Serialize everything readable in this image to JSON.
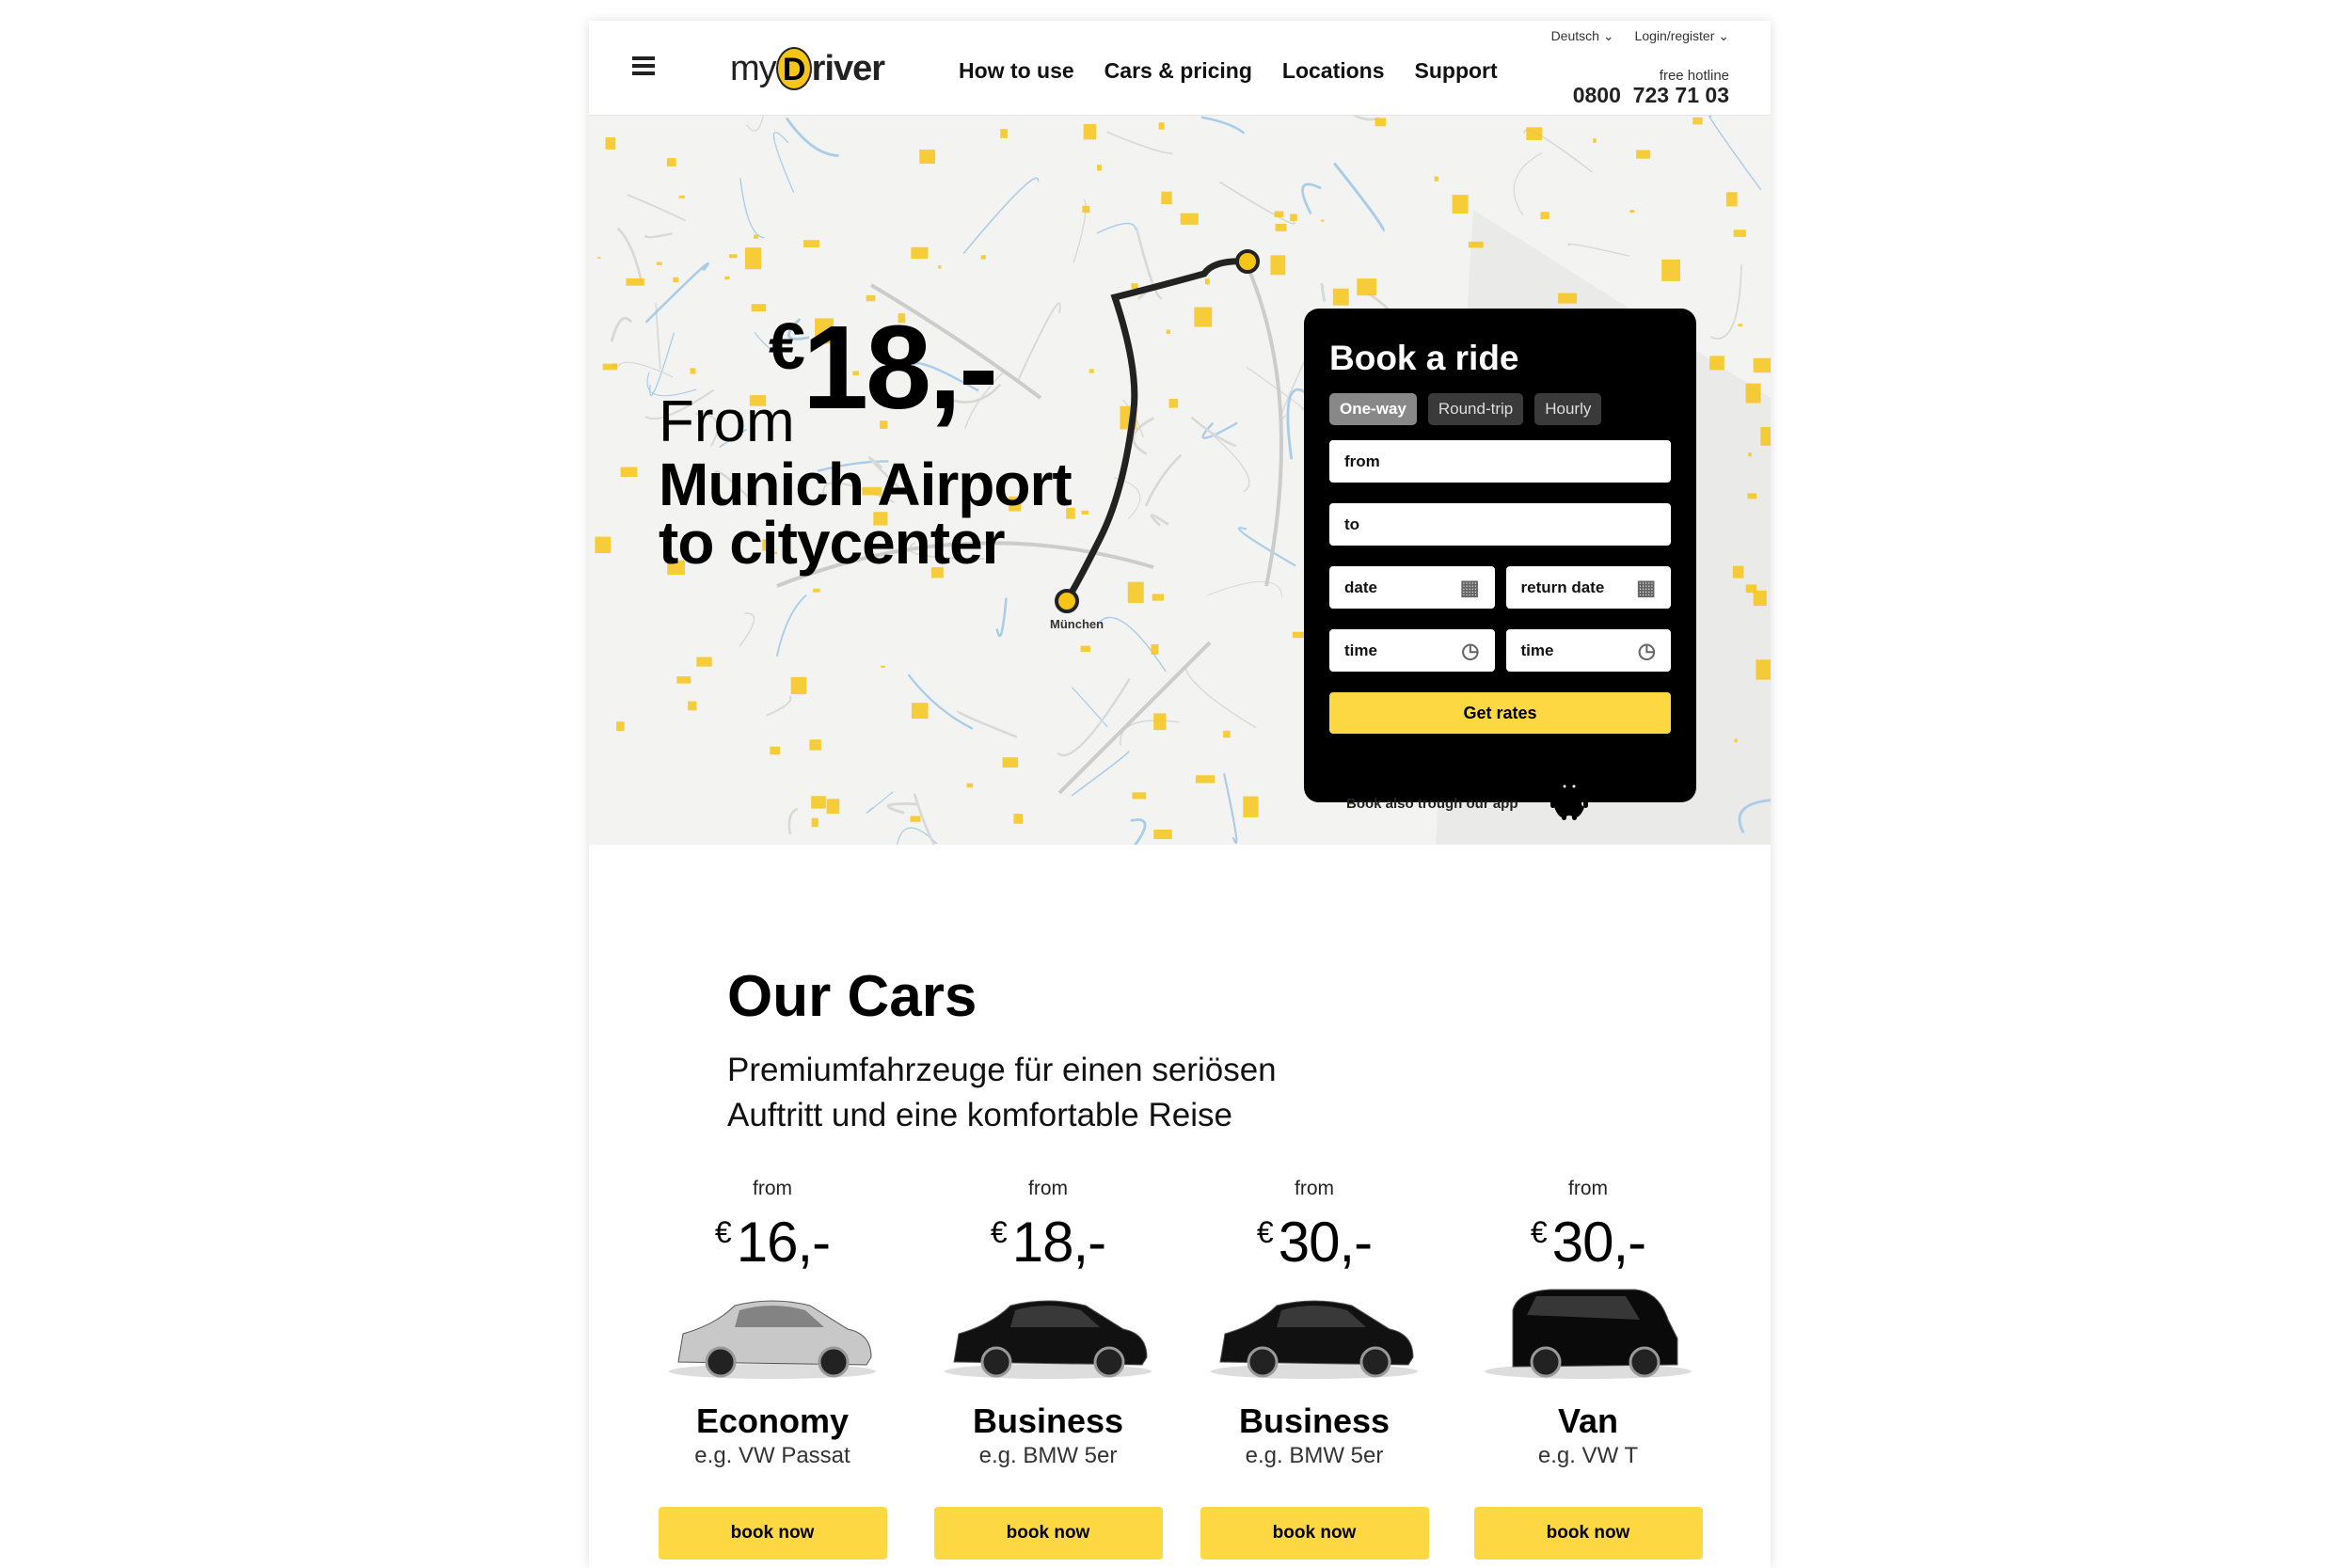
{
  "header": {
    "logo": "myDriver",
    "logo_my": "my",
    "logo_d": "D",
    "logo_rest": "river",
    "nav": [
      "How to use",
      "Cars & pricing",
      "Locations",
      "Support"
    ],
    "language": "Deutsch",
    "login": "Login/register",
    "hotline_label": "free hotline",
    "hotline": "0800  723 71 03"
  },
  "hero": {
    "price_currency": "€",
    "price": "18,-",
    "from": "From",
    "line1": "Munich Airport",
    "line2": "to citycenter"
  },
  "map": {
    "label_start": "München",
    "accent": "#f6c617"
  },
  "booking": {
    "title": "Book a ride",
    "tabs": [
      "One-way",
      "Round-trip",
      "Hourly"
    ],
    "active_tab": "One-way",
    "from_placeholder": "from",
    "to_placeholder": "to",
    "date_placeholder": "date",
    "return_date_placeholder": "return date",
    "time_placeholder": "time",
    "return_time_placeholder": "time",
    "submit": "Get rates",
    "app_text": "Book also trough our app"
  },
  "cars": {
    "title": "Our Cars",
    "subtitle_1": "Premiumfahrzeuge für einen seriösen",
    "subtitle_2": "Auftritt und eine komfortable Reise",
    "items": [
      {
        "from": "from",
        "currency": "€",
        "price": "16,-",
        "name": "Economy",
        "example": "e.g. VW Passat",
        "button": "book now",
        "color": "#c8c8c8"
      },
      {
        "from": "from",
        "currency": "€",
        "price": "18,-",
        "name": "Business",
        "example": "e.g. BMW 5er",
        "button": "book now",
        "color": "#111111"
      },
      {
        "from": "from",
        "currency": "€",
        "price": "30,-",
        "name": "Business",
        "example": "e.g. BMW 5er",
        "button": "book now",
        "color": "#111111"
      },
      {
        "from": "from",
        "currency": "€",
        "price": "30,-",
        "name": "Van",
        "example": "e.g. VW T",
        "button": "book now",
        "color": "#0a0a0a"
      }
    ]
  },
  "colors": {
    "accent": "#fdd843",
    "panel": "#000000"
  }
}
